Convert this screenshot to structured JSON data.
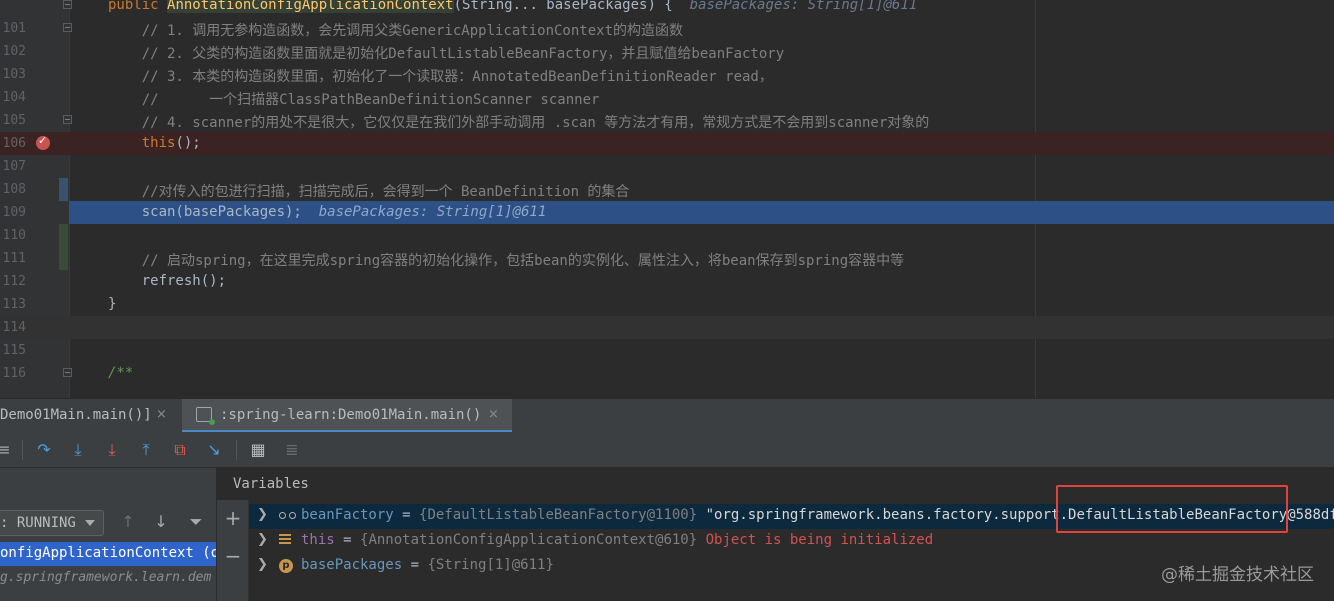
{
  "editor": {
    "lines": [
      {
        "num": "",
        "parts": [
          [
            "kw",
            "public "
          ],
          [
            "fn",
            "AnnotationConfigApplicationContext"
          ],
          [
            "tx",
            "(String... basePackages) {  "
          ],
          [
            "inl",
            "basePackages: String[1]@611"
          ]
        ]
      },
      {
        "num": "101",
        "parts": [
          [
            "cm",
            "    // 1. 调用无参构造函数，会先调用父类GenericApplicationContext的构造函数"
          ]
        ]
      },
      {
        "num": "102",
        "parts": [
          [
            "cm",
            "    // 2. 父类的构造函数里面就是初始化DefaultListableBeanFactory，并且赋值给beanFactory"
          ]
        ]
      },
      {
        "num": "103",
        "parts": [
          [
            "cm",
            "    // 3. 本类的构造函数里面，初始化了一个读取器：AnnotatedBeanDefinitionReader read，"
          ]
        ]
      },
      {
        "num": "104",
        "parts": [
          [
            "cm",
            "    //      一个扫描器ClassPathBeanDefinitionScanner scanner"
          ]
        ]
      },
      {
        "num": "105",
        "parts": [
          [
            "cm",
            "    // 4. scanner的用处不是很大，它仅仅是在我们外部手动调用 .scan 等方法才有用，常规方式是不会用到scanner对象的"
          ]
        ]
      },
      {
        "num": "106",
        "parts": [
          [
            "kw",
            "    this"
          ],
          [
            "tx",
            "();"
          ]
        ]
      },
      {
        "num": "107",
        "parts": []
      },
      {
        "num": "108",
        "parts": [
          [
            "cm",
            "    //对传入的包进行扫描，扫描完成后，会得到一个 BeanDefinition 的集合"
          ]
        ]
      },
      {
        "num": "109",
        "parts": [
          [
            "tx",
            "    scan(basePackages);  "
          ],
          [
            "inlx",
            "basePackages: String[1]@611"
          ]
        ]
      },
      {
        "num": "110",
        "parts": []
      },
      {
        "num": "111",
        "parts": [
          [
            "cm",
            "    // 启动spring，在这里完成spring容器的初始化操作，包括bean的实例化、属性注入，将bean保存到spring容器中等"
          ]
        ]
      },
      {
        "num": "112",
        "parts": [
          [
            "tx",
            "    refresh();"
          ]
        ]
      },
      {
        "num": "113",
        "parts": [
          [
            "tx",
            "}"
          ]
        ]
      },
      {
        "num": "114",
        "parts": []
      },
      {
        "num": "115",
        "parts": []
      },
      {
        "num": "116",
        "parts": [
          [
            "doc",
            "/**"
          ]
        ]
      }
    ]
  },
  "tabs": [
    {
      "label": "Demo01Main.main()]",
      "close": "×"
    },
    {
      "label": ":spring-learn:Demo01Main.main()",
      "close": "×"
    }
  ],
  "toolbar": {
    "icons": [
      "menu-icon",
      "step-over-icon",
      "step-into-icon",
      "force-step-into-icon",
      "step-out-icon",
      "drop-frame-icon",
      "run-to-cursor-icon",
      "evaluate-expression-icon",
      "trace-icon"
    ]
  },
  "frames": {
    "thread_status": ": RUNNING",
    "rows": [
      {
        "text": "onfigApplicationContext (or",
        "selected": true
      },
      {
        "text": "g.springframework.learn.dem",
        "selected": false
      }
    ]
  },
  "variables": {
    "title": "Variables",
    "rows": [
      {
        "name": "beanFactory",
        "eq": " = ",
        "type": "{DefaultListableBeanFactory@1100} ",
        "value": "\"org.springframework.beans.factory.support.DefaultListableBeanFactory@588df",
        "value_class": "vstr",
        "icon": "glasses-icon",
        "selected": true
      },
      {
        "name": "this",
        "eq": " = ",
        "type": "{AnnotationConfigApplicationContext@610} ",
        "value": "Object is being initialized",
        "value_class": "vwarn",
        "icon": "stack-icon",
        "selected": false
      },
      {
        "name": "basePackages",
        "eq": " = ",
        "type": "{String[1]@611}",
        "value": "",
        "value_class": "vstr",
        "icon": "parameter-icon",
        "selected": false
      }
    ],
    "parameter_icon_letter": "p"
  },
  "watermark": "@稀土掘金技术社区",
  "colors": {
    "accent": "#4a88c7",
    "execution_line": "#2d5186",
    "breakpoint": "#c75450",
    "highlight_box": "#e0433a"
  }
}
